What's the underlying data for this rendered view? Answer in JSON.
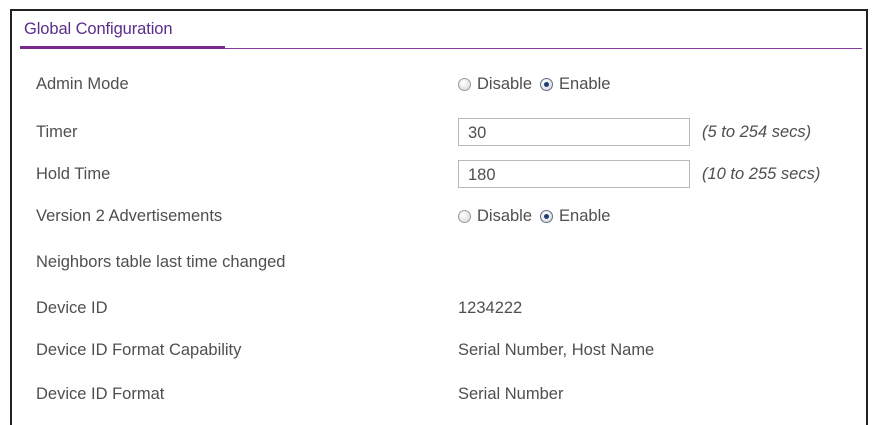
{
  "section": {
    "title": "Global Configuration"
  },
  "admin_mode": {
    "label": "Admin Mode",
    "option_disable": "Disable",
    "option_enable": "Enable",
    "selected": "Enable"
  },
  "timer": {
    "label": "Timer",
    "value": "30",
    "hint": "(5 to 254 secs)"
  },
  "hold_time": {
    "label": "Hold Time",
    "value": "180",
    "hint": "(10 to 255 secs)"
  },
  "v2_ads": {
    "label": "Version 2 Advertisements",
    "option_disable": "Disable",
    "option_enable": "Enable",
    "selected": "Enable"
  },
  "neighbors": {
    "label": "Neighbors table last time changed",
    "value": ""
  },
  "device_id": {
    "label": "Device ID",
    "value": "1234222"
  },
  "device_id_capability": {
    "label": "Device ID Format Capability",
    "value": "Serial Number, Host Name"
  },
  "device_id_format": {
    "label": "Device ID Format",
    "value": "Serial Number"
  },
  "colors": {
    "accent": "#7a2a8c",
    "title": "#5a2d88",
    "text": "#4f4f4f"
  }
}
